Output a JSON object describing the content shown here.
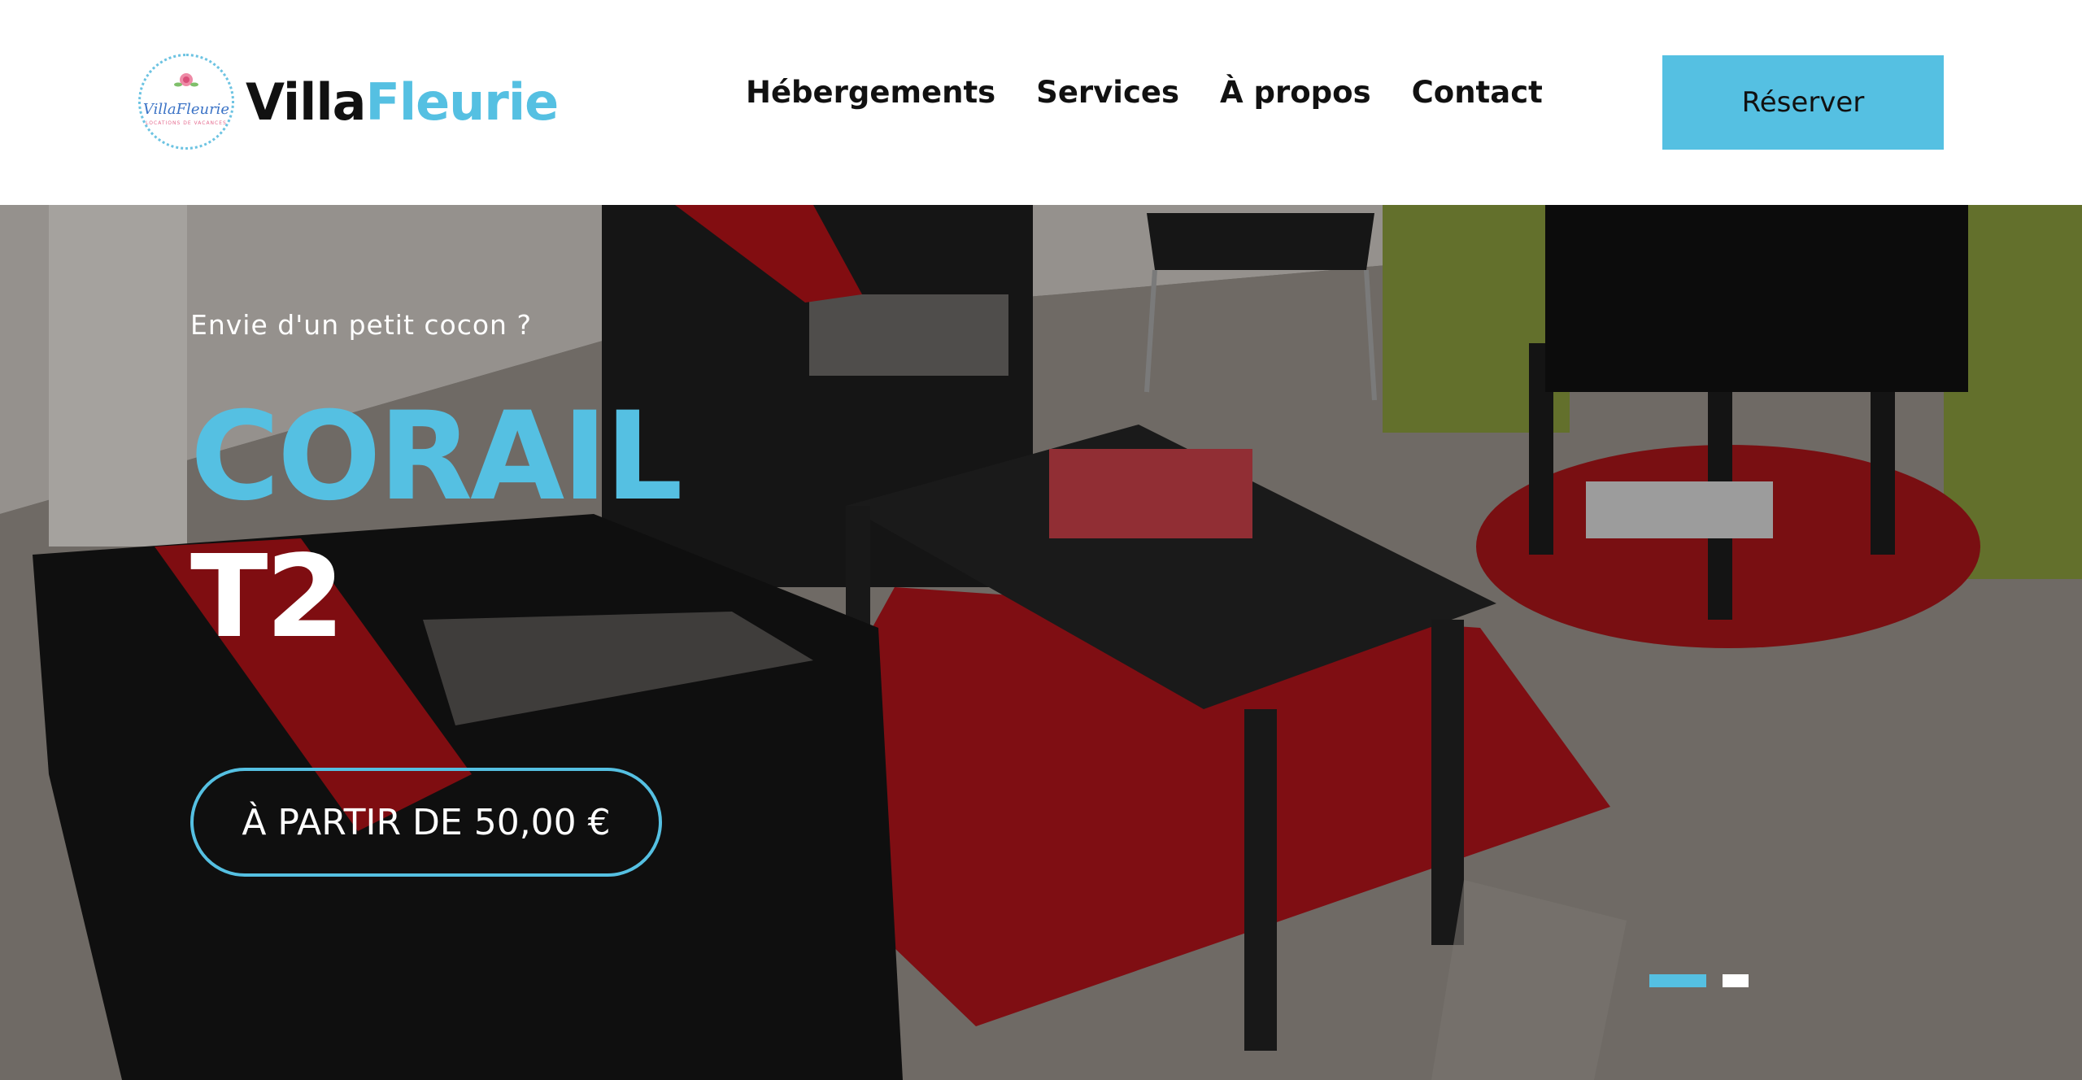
{
  "header": {
    "logo_badge_text": "VillaFleurie",
    "logo_badge_subtext": "LOCATIONS DE VACANCES",
    "brand_part1": "Villa",
    "brand_part2": "Fleurie",
    "nav": [
      {
        "label": "Hébergements"
      },
      {
        "label": "Services"
      },
      {
        "label": "À propos"
      },
      {
        "label": "Contact"
      }
    ],
    "cta_label": "Réserver"
  },
  "hero": {
    "kicker": "Envie d'un petit cocon ?",
    "title_line1": "CORAIL",
    "title_line2": "T2",
    "price_label": "À PARTIR DE 50,00 €",
    "slides": {
      "count": 2,
      "active_index": 0
    }
  },
  "colors": {
    "accent": "#55c0e2",
    "text_dark": "#111111",
    "white": "#ffffff"
  },
  "icons": [
    "logo-badge-icon",
    "flower-icon"
  ]
}
